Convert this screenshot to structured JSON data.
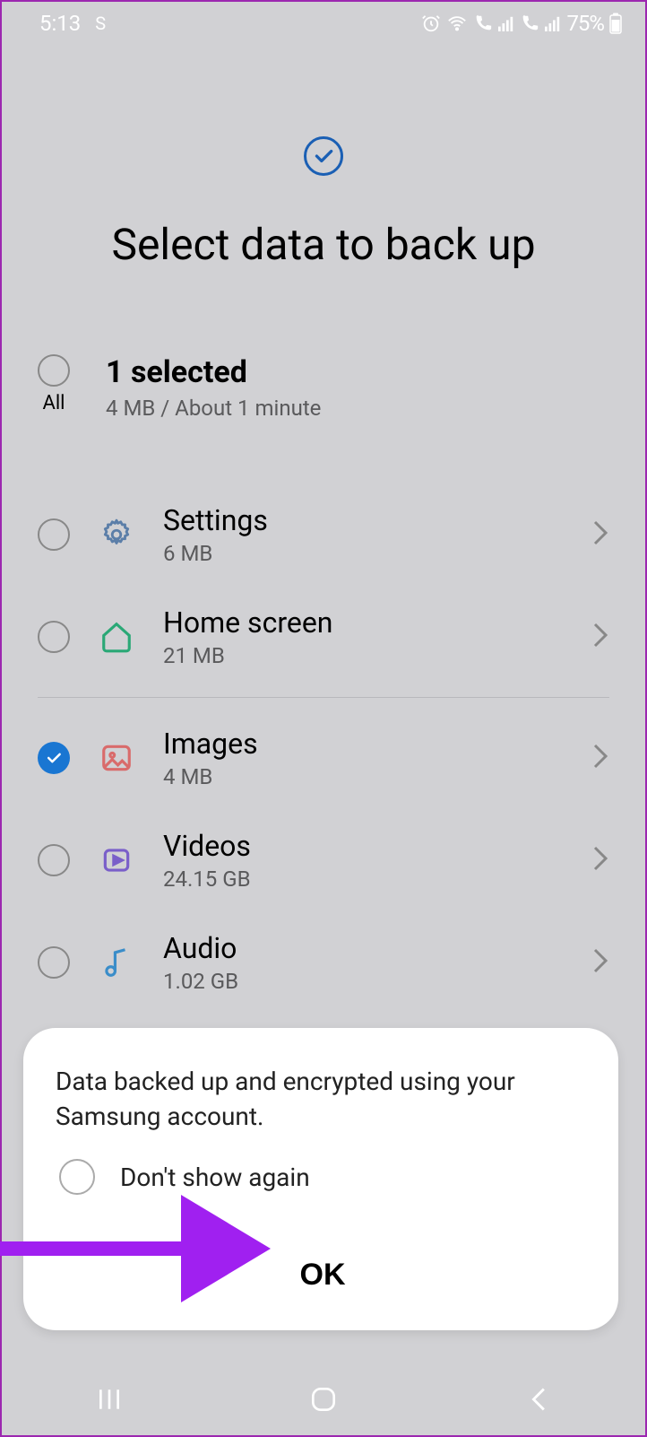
{
  "status": {
    "time": "5:13",
    "indicator": "S",
    "battery": "75%"
  },
  "header": {
    "title": "Select data to back up"
  },
  "summary": {
    "all_label": "All",
    "selected": "1 selected",
    "estimate": "4 MB / About 1 minute"
  },
  "items": [
    {
      "name": "Settings",
      "size": "6 MB",
      "icon": "gear",
      "checked": false
    },
    {
      "name": "Home screen",
      "size": "21 MB",
      "icon": "home",
      "checked": false
    },
    {
      "name": "Images",
      "size": "4 MB",
      "icon": "image",
      "checked": true
    },
    {
      "name": "Videos",
      "size": "24.15 GB",
      "icon": "video",
      "checked": false
    },
    {
      "name": "Audio",
      "size": "1.02 GB",
      "icon": "audio",
      "checked": false
    }
  ],
  "dialog": {
    "message": "Data backed up and encrypted using your Samsung account.",
    "dont_show": "Don't show again",
    "ok": "OK"
  },
  "colors": {
    "accent": "#1976d2",
    "annotation": "#a020f0"
  }
}
